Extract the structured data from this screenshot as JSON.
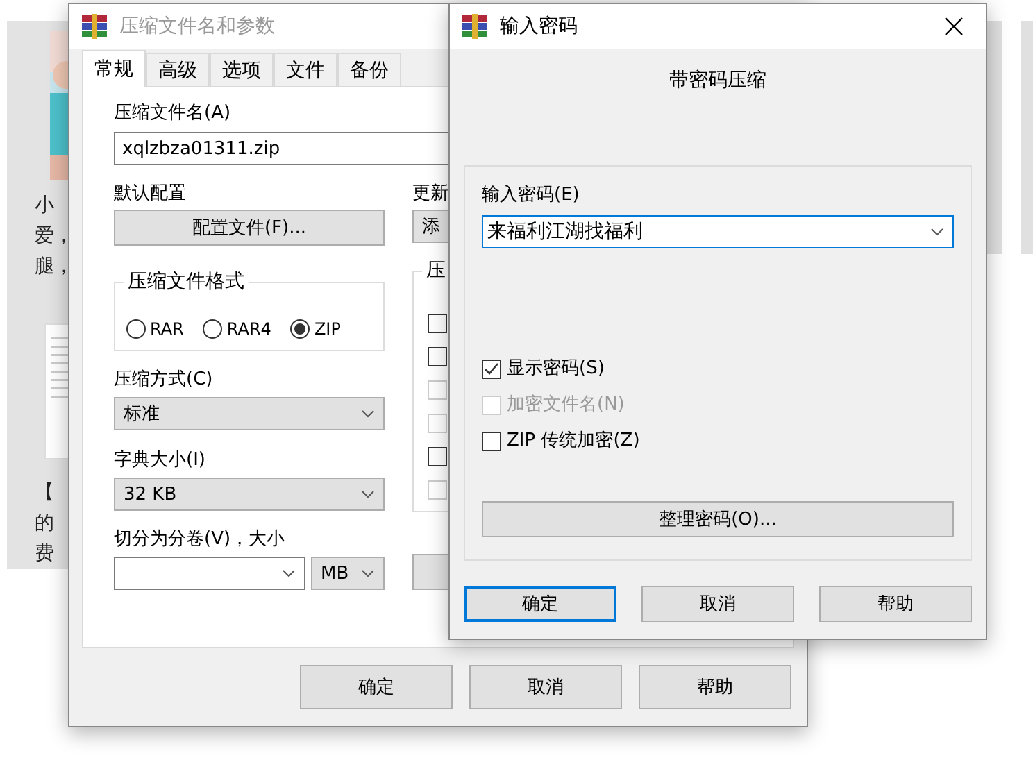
{
  "background_cards": [
    {
      "lines": [
        "小",
        "爱，",
        "腿，"
      ]
    },
    {
      "kind": "document",
      "lines": [
        "【",
        "的",
        "费"
      ]
    }
  ],
  "archive_dialog": {
    "title": "压缩文件名和参数",
    "tabs": [
      {
        "label": "常规",
        "selected": true
      },
      {
        "label": "高级",
        "selected": false
      },
      {
        "label": "选项",
        "selected": false
      },
      {
        "label": "文件",
        "selected": false
      },
      {
        "label": "备份",
        "selected": false
      }
    ],
    "archive_name_label": "压缩文件名(A)",
    "archive_name": "xqlzbza01311.zip",
    "profile_label": "默认配置",
    "profile_button": "配置文件(F)...",
    "update_label": "更新",
    "update_value": "添",
    "format_group": "压缩文件格式",
    "formats": [
      {
        "label": "RAR",
        "selected": false
      },
      {
        "label": "RAR4",
        "selected": false
      },
      {
        "label": "ZIP",
        "selected": true
      }
    ],
    "method_label": "压缩方式(C)",
    "method": "标准",
    "dict_label": "字典大小(I)",
    "dict": "32 KB",
    "split_label": "切分为分卷(V)，大小",
    "split_unit": "MB",
    "options_group": "压",
    "options": [
      {
        "checked": false,
        "disabled": false
      },
      {
        "checked": false,
        "disabled": false
      },
      {
        "checked": false,
        "disabled": true
      },
      {
        "checked": false,
        "disabled": true
      },
      {
        "checked": false,
        "disabled": false
      },
      {
        "checked": false,
        "disabled": true
      }
    ],
    "buttons": [
      "确定",
      "取消",
      "帮助"
    ]
  },
  "password_dialog": {
    "title": "输入密码",
    "heading": "带密码压缩",
    "password_label": "输入密码(E)",
    "password": "来福利江湖找福利",
    "options": [
      {
        "label": "显示密码(S)",
        "checked": true,
        "disabled": false
      },
      {
        "label": "加密文件名(N)",
        "checked": false,
        "disabled": true
      },
      {
        "label": "ZIP 传统加密(Z)",
        "checked": false,
        "disabled": false
      }
    ],
    "organize_button": "整理密码(O)...",
    "buttons": [
      {
        "label": "确定",
        "focused": true
      },
      {
        "label": "取消",
        "focused": false
      },
      {
        "label": "帮助",
        "focused": false
      }
    ]
  }
}
